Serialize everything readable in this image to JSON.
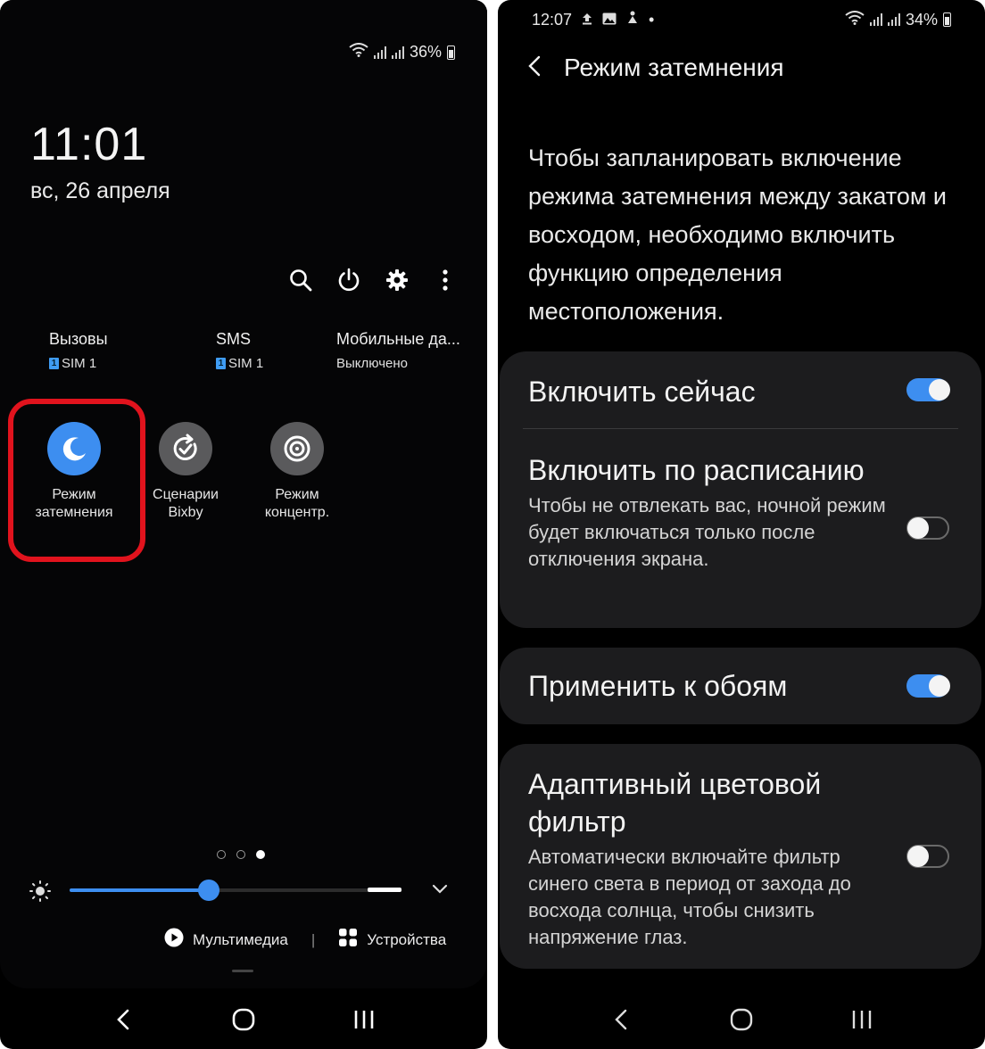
{
  "left": {
    "status": {
      "battery": "36%"
    },
    "clock": "11:01",
    "date": "вс, 26 апреля",
    "toolbar": [
      "search-icon",
      "power-icon",
      "gear-icon",
      "more-icon"
    ],
    "sims": [
      {
        "title": "Вызовы",
        "sub": "SIM 1",
        "badge": "1"
      },
      {
        "title": "SMS",
        "sub": "SIM 1",
        "badge": "1"
      },
      {
        "title": "Мобильные да...",
        "sub": "Выключено"
      }
    ],
    "tiles": [
      {
        "line1": "Режим",
        "line2": "затемнения",
        "state": "on",
        "icon": "moon-icon",
        "color": "#3d8ef0"
      },
      {
        "line1": "Сценарии",
        "line2": "Bixby",
        "state": "off",
        "icon": "bixby-routine-icon",
        "color": "#5a5a5c"
      },
      {
        "line1": "Режим",
        "line2": "концентр.",
        "state": "off",
        "icon": "focus-icon",
        "color": "#5a5a5c"
      }
    ],
    "page_indicator": {
      "pages": 3,
      "current": 3
    },
    "brightness": {
      "level": 0.42
    },
    "media_label": "Мультимедиа",
    "separator": "|",
    "devices_label": "Устройства",
    "highlight_color": "#e1131d"
  },
  "right": {
    "status": {
      "time": "12:07",
      "dot": "•",
      "battery": "34%"
    },
    "header_title": "Режим затемнения",
    "intro": "Чтобы запланировать включение режима затемнения между закатом и восходом, необходимо включить функцию определения местоположения.",
    "settings": {
      "enable_now": {
        "title": "Включить сейчас",
        "value": true
      },
      "schedule": {
        "title": "Включить по расписанию",
        "desc": "Чтобы не отвлекать вас, ночной режим будет включаться только после отключения экрана.",
        "value": false
      },
      "wallpaper": {
        "title": "Применить к обоям",
        "value": true
      },
      "adaptive": {
        "title": "Адаптивный цветовой фильтр",
        "desc": "Автоматически включайте фильтр синего света в период от захода до восхода солнца, чтобы снизить напряжение глаз.",
        "value": false
      }
    },
    "accent_color": "#3d8ef0"
  }
}
